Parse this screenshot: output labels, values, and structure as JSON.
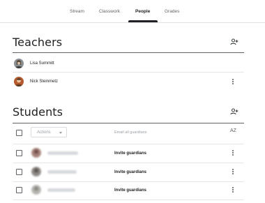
{
  "tabs": [
    {
      "label": "Stream",
      "active": false
    },
    {
      "label": "Classwork",
      "active": false
    },
    {
      "label": "People",
      "active": true
    },
    {
      "label": "Grades",
      "active": false
    }
  ],
  "teachers": {
    "title": "Teachers",
    "add_icon": "person-add-icon",
    "members": [
      {
        "name": "Lisa Summitt"
      },
      {
        "name": "Nick Steinmetz"
      }
    ]
  },
  "students": {
    "title": "Students",
    "add_icon": "person-add-icon",
    "actions_label": "Actions",
    "email_all_label": "Email all guardians",
    "sort_icon": "sort-az-icon",
    "sort_label": "AZ",
    "rows": [
      {
        "invite_label": "Invite guardians"
      },
      {
        "invite_label": "Invite guardians"
      },
      {
        "invite_label": "Invite guardians"
      }
    ]
  },
  "colors": {
    "active_tab": "#202124",
    "text": "#202124",
    "muted": "#5f6368"
  }
}
